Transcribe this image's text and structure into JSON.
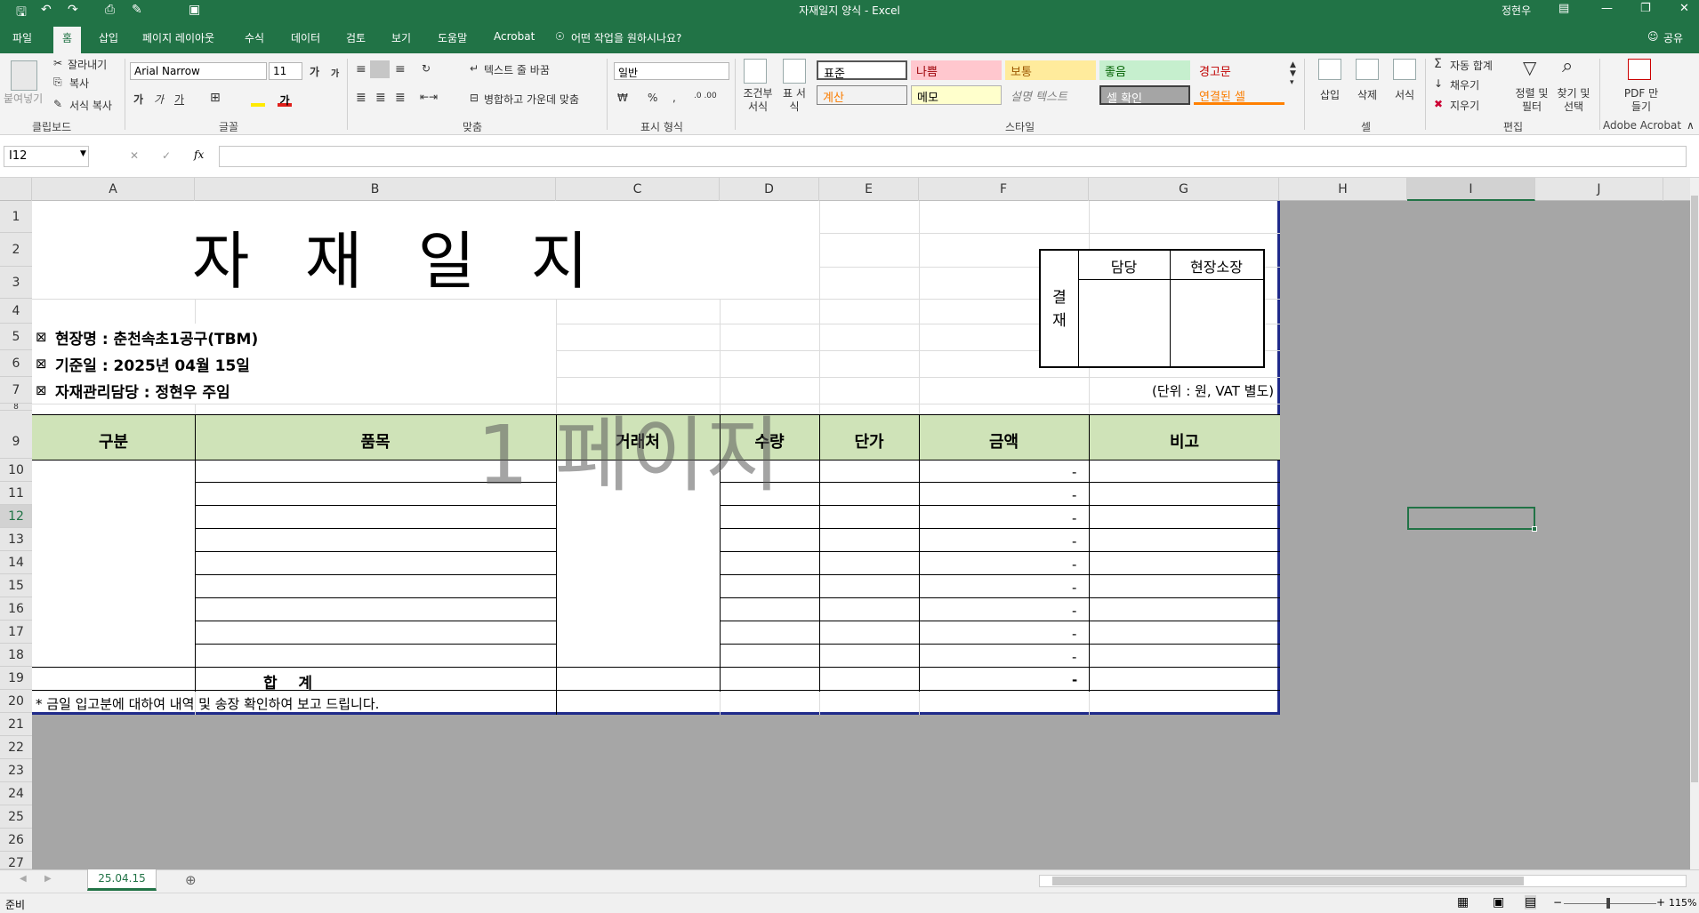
{
  "window": {
    "title": "자재일지 양식  -  Excel",
    "user": "정현우"
  },
  "tabs": [
    "파일",
    "홈",
    "삽입",
    "페이지 레이아웃",
    "수식",
    "데이터",
    "검토",
    "보기",
    "도움말",
    "Acrobat"
  ],
  "tell_me": "어떤 작업을 원하시나요?",
  "share": "공유",
  "ribbon": {
    "clipboard": {
      "paste": "붙여넣기",
      "cut": "잘라내기",
      "copy": "복사",
      "format_painter": "서식 복사",
      "label": "클립보드"
    },
    "font": {
      "name": "Arial Narrow",
      "size": "11",
      "label": "글꼴",
      "bold": "가",
      "italic": "가",
      "underline": "가",
      "grow": "가",
      "shrink": "가"
    },
    "alignment": {
      "wrap": "텍스트 줄 바꿈",
      "merge": "병합하고 가운데 맞춤",
      "label": "맞춤"
    },
    "number": {
      "format": "일반",
      "percent": "%",
      "comma": ",",
      "label": "표시 형식"
    },
    "styles": {
      "conditional": "조건부 서식",
      "table": "표 서식",
      "label": "스타일",
      "cells": [
        "표준",
        "나쁨",
        "보통",
        "좋음",
        "경고문",
        "계산",
        "메모",
        "설명 텍스트",
        "셀 확인",
        "연결된 셀"
      ]
    },
    "cells": {
      "insert": "삽입",
      "delete": "삭제",
      "format": "서식",
      "label": "셀"
    },
    "editing": {
      "autosum": "자동 합계",
      "fill": "채우기",
      "clear": "지우기",
      "sort": "정렬 및 필터",
      "find": "찾기 및 선택",
      "label": "편집"
    },
    "acrobat": {
      "pdf": "PDF 만들기",
      "label": "Adobe Acrobat"
    }
  },
  "formula_bar": {
    "name_box": "I12",
    "fx": "fx",
    "value": ""
  },
  "columns": [
    "A",
    "B",
    "C",
    "D",
    "E",
    "F",
    "G",
    "H",
    "I",
    "J"
  ],
  "rows": [
    "1",
    "2",
    "3",
    "4",
    "5",
    "6",
    "7",
    "8",
    "9",
    "10",
    "11",
    "12",
    "13",
    "14",
    "15",
    "16",
    "17",
    "18",
    "19",
    "20",
    "21",
    "22",
    "23",
    "24",
    "25",
    "26",
    "27"
  ],
  "sheet": {
    "title": "자  재  일  지",
    "site": "현장명 : 춘천속초1공구(TBM)",
    "date": "기준일 : 2025년 04월 15일",
    "manager": "자재관리담당 : 정현우 주임",
    "approval": {
      "label": "결 재",
      "col1": "담당",
      "col2": "현장소장"
    },
    "unit_note": "(단위 : 원, VAT 별도)",
    "headers": [
      "구분",
      "품목",
      "거래처",
      "수량",
      "단가",
      "금액",
      "비고"
    ],
    "amount_dashes": [
      "-",
      "-",
      "-",
      "-",
      "-",
      "-",
      "-",
      "-",
      "-"
    ],
    "total_label": "합    계",
    "total_amount": "-",
    "footnote": "* 금일 입고분에 대하여 내역 및 송장 확인하여 보고 드립니다.",
    "page_watermark": "1 페이지"
  },
  "sheet_tab": "25.04.15",
  "status": {
    "ready": "준비",
    "zoom": "115%"
  }
}
